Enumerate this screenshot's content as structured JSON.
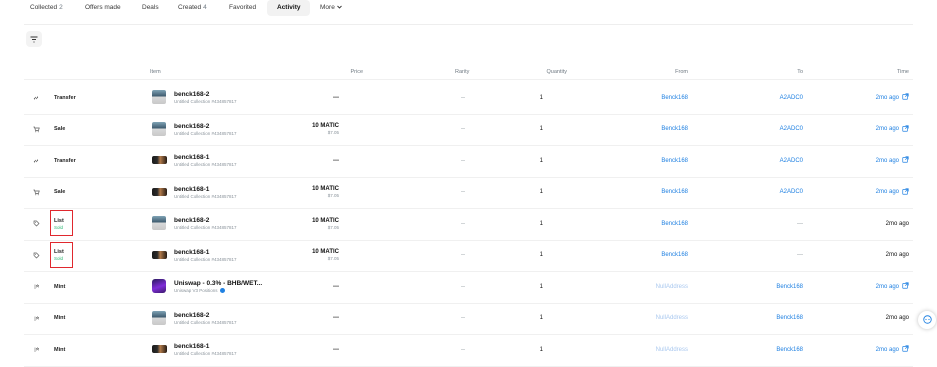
{
  "tabs": [
    {
      "label": "Collected",
      "count": "2"
    },
    {
      "label": "Offers made",
      "count": ""
    },
    {
      "label": "Deals",
      "count": ""
    },
    {
      "label": "Created",
      "count": "4"
    },
    {
      "label": "Favorited",
      "count": ""
    },
    {
      "label": "Activity",
      "count": "",
      "active": true
    },
    {
      "label": "More",
      "count": ""
    }
  ],
  "filter": {
    "icon": "filter-icon"
  },
  "headers": {
    "item": "Item",
    "price": "Price",
    "rarity": "Rarity",
    "quantity": "Quantity",
    "from": "From",
    "to": "To",
    "time": "Time"
  },
  "rows": [
    {
      "icon": "transfer-icon",
      "event": "Transfer",
      "sub": "",
      "thumb": "t2",
      "name": "benck168-2",
      "collection": "Untitled Collection #434857817",
      "price": "---",
      "usd": "",
      "rarity": "--",
      "qty": "1",
      "from": "Benck168",
      "to": "A2ADC0",
      "time": "2mo ago",
      "link": true
    },
    {
      "icon": "cart-icon",
      "event": "Sale",
      "sub": "",
      "thumb": "t2",
      "name": "benck168-2",
      "collection": "Untitled Collection #434857817",
      "price": "10 MATIC",
      "usd": "$7.05",
      "rarity": "--",
      "qty": "1",
      "from": "Benck168",
      "to": "A2ADC0",
      "time": "2mo ago",
      "link": true
    },
    {
      "icon": "transfer-icon",
      "event": "Transfer",
      "sub": "",
      "thumb": "t1",
      "name": "benck168-1",
      "collection": "Untitled Collection #434857817",
      "price": "---",
      "usd": "",
      "rarity": "--",
      "qty": "1",
      "from": "Benck168",
      "to": "A2ADC0",
      "time": "2mo ago",
      "link": true
    },
    {
      "icon": "cart-icon",
      "event": "Sale",
      "sub": "",
      "thumb": "t1",
      "name": "benck168-1",
      "collection": "Untitled Collection #434857817",
      "price": "10 MATIC",
      "usd": "$7.05",
      "rarity": "--",
      "qty": "1",
      "from": "Benck168",
      "to": "A2ADC0",
      "time": "2mo ago",
      "link": true
    },
    {
      "icon": "tag-icon",
      "event": "List",
      "sub": "Sold",
      "thumb": "t2",
      "name": "benck168-2",
      "collection": "Untitled Collection #434857817",
      "price": "10 MATIC",
      "usd": "$7.05",
      "rarity": "--",
      "qty": "1",
      "from": "Benck168",
      "to": "---",
      "time": "2mo ago",
      "link": false,
      "highlight": true
    },
    {
      "icon": "tag-icon",
      "event": "List",
      "sub": "Sold",
      "thumb": "t1",
      "name": "benck168-1",
      "collection": "Untitled Collection #434857817",
      "price": "10 MATIC",
      "usd": "$7.05",
      "rarity": "--",
      "qty": "1",
      "from": "Benck168",
      "to": "---",
      "time": "2mo ago",
      "link": false,
      "highlight": true
    },
    {
      "icon": "mint-icon",
      "event": "Mint",
      "sub": "",
      "thumb": "tu",
      "name": "Uniswap - 0.3% - BHB/WET...",
      "collection": "Uniswap V3 Positions",
      "verified": true,
      "price": "---",
      "usd": "",
      "rarity": "--",
      "qty": "1",
      "from": "NullAddress",
      "to": "Benck168",
      "time": "2mo ago",
      "link": true
    },
    {
      "icon": "mint-icon",
      "event": "Mint",
      "sub": "",
      "thumb": "t2",
      "name": "benck168-2",
      "collection": "Untitled Collection #434857817",
      "price": "---",
      "usd": "",
      "rarity": "--",
      "qty": "1",
      "from": "NullAddress",
      "to": "Benck168",
      "time": "2mo ago",
      "link": false
    },
    {
      "icon": "mint-icon",
      "event": "Mint",
      "sub": "",
      "thumb": "t1",
      "name": "benck168-1",
      "collection": "Untitled Collection #434857817",
      "price": "---",
      "usd": "",
      "rarity": "--",
      "qty": "1",
      "from": "NullAddress",
      "to": "Benck168",
      "time": "2mo ago",
      "link": true
    }
  ],
  "chat": {
    "icon": "chat-icon"
  }
}
